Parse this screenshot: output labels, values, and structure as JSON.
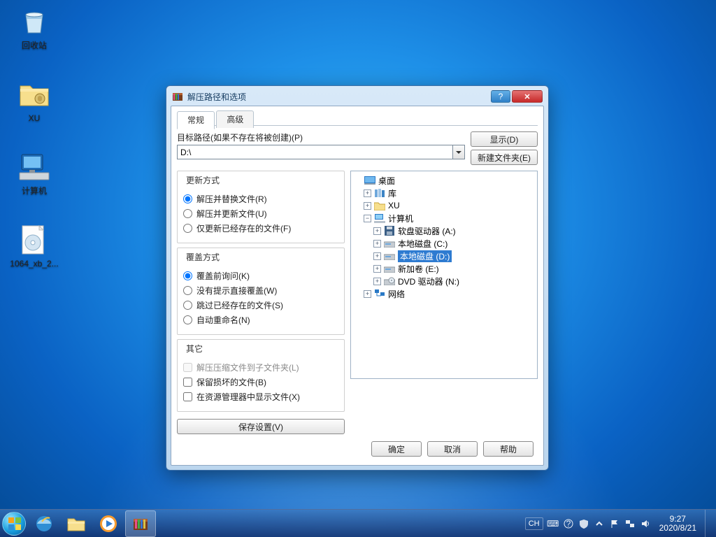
{
  "desktop_icons": {
    "recycle": "回收站",
    "xu": "XU",
    "computer": "计算机",
    "file": "1064_xb_2..."
  },
  "window": {
    "title": "解压路径和选项",
    "help": "?",
    "tabs": {
      "general": "常规",
      "advanced": "高级"
    },
    "dest_label": "目标路径(如果不存在将被创建)(P)",
    "dest_value": "D:\\",
    "display_btn": "显示(D)",
    "newfolder_btn": "新建文件夹(E)",
    "update": {
      "legend": "更新方式",
      "r1": "解压并替换文件(R)",
      "r2": "解压并更新文件(U)",
      "r3": "仅更新已经存在的文件(F)"
    },
    "overwrite": {
      "legend": "覆盖方式",
      "r1": "覆盖前询问(K)",
      "r2": "没有提示直接覆盖(W)",
      "r3": "跳过已经存在的文件(S)",
      "r4": "自动重命名(N)"
    },
    "other": {
      "legend": "其它",
      "c1": "解压压缩文件到子文件夹(L)",
      "c2": "保留损坏的文件(B)",
      "c3": "在资源管理器中显示文件(X)"
    },
    "save_btn": "保存设置(V)",
    "ok": "确定",
    "cancel": "取消",
    "help_btn": "帮助"
  },
  "tree": {
    "desktop": "桌面",
    "lib": "库",
    "xu": "XU",
    "computer": "计算机",
    "floppy": "软盘驱动器 (A:)",
    "c": "本地磁盘 (C:)",
    "d": "本地磁盘 (D:)",
    "e": "新加卷 (E:)",
    "dvd": "DVD 驱动器 (N:)",
    "network": "网络"
  },
  "taskbar": {
    "lang": "CH",
    "kb": "⌨",
    "time": "9:27",
    "date": "2020/8/21"
  }
}
